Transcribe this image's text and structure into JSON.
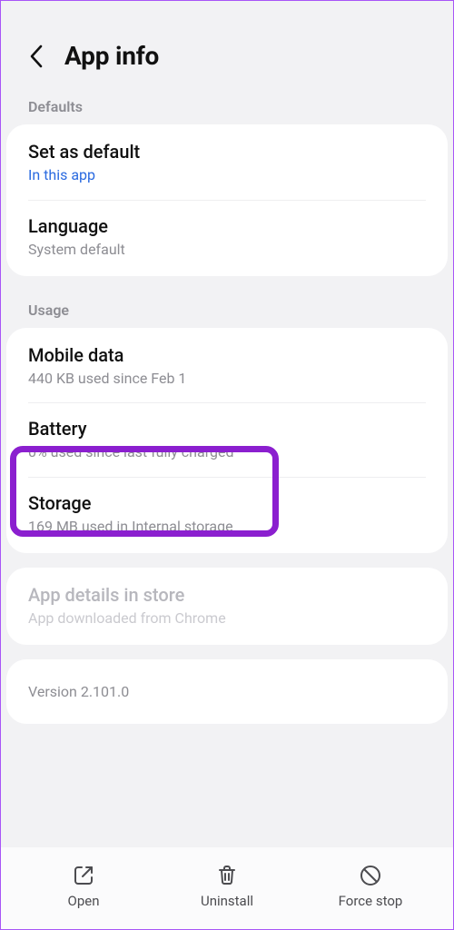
{
  "header": {
    "title": "App info"
  },
  "sections": {
    "defaults_label": "Defaults",
    "usage_label": "Usage"
  },
  "defaults": {
    "set_default": {
      "title": "Set as default",
      "sub": "In this app"
    },
    "language": {
      "title": "Language",
      "sub": "System default"
    }
  },
  "usage": {
    "mobile_data": {
      "title": "Mobile data",
      "sub": "440 KB used since Feb 1"
    },
    "battery": {
      "title": "Battery",
      "sub": "0% used since last fully charged"
    },
    "storage": {
      "title": "Storage",
      "sub": "169 MB used in Internal storage"
    }
  },
  "store": {
    "title": "App details in store",
    "sub": "App downloaded from Chrome"
  },
  "version": "Version 2.101.0",
  "bottom": {
    "open": "Open",
    "uninstall": "Uninstall",
    "force_stop": "Force stop"
  }
}
